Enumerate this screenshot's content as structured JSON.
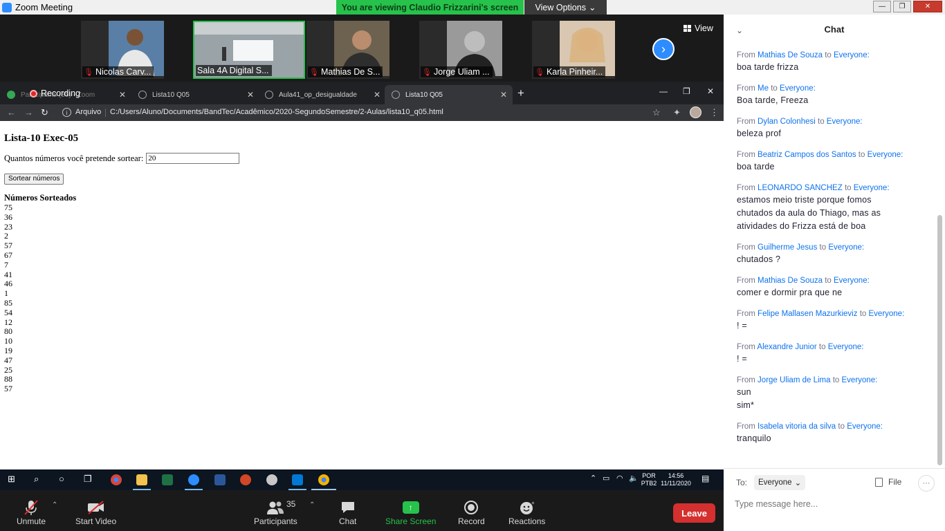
{
  "zoom": {
    "window_title": "Zoom Meeting",
    "viewing_banner": "You are viewing Claudio Frizzarini's screen",
    "view_options": "View Options",
    "view_label": "View"
  },
  "participants_strip": [
    {
      "name": "Nicolas Carv..."
    },
    {
      "name": "Sala 4A Digital S..."
    },
    {
      "name": "Mathias De S..."
    },
    {
      "name": "Jorge Uliam ..."
    },
    {
      "name": "Karla Pinheir..."
    }
  ],
  "recording_label": "Recording",
  "browser": {
    "tabs": [
      {
        "label": "Participants (35) - Zoom"
      },
      {
        "label": "Lista10 Q05"
      },
      {
        "label": "Aula41_op_desigualdade"
      },
      {
        "label": "Lista10 Q05"
      }
    ],
    "address_prefix": "Arquivo",
    "address_url": "C:/Users/Aluno/Documents/BandTec/Acadêmico/2020-SegundoSemestre/2-Aulas/lista10_q05.html"
  },
  "page": {
    "title": "Lista-10 Exec-05",
    "prompt_label": "Quantos números você pretende sortear:",
    "input_value": "20",
    "button_label": "Sortear números",
    "results_heading": "Números Sorteados",
    "numbers": [
      "75",
      "36",
      "23",
      "2",
      "57",
      "67",
      "7",
      "41",
      "46",
      "1",
      "85",
      "54",
      "12",
      "80",
      "10",
      "19",
      "47",
      "25",
      "88",
      "57"
    ]
  },
  "taskbar": {
    "lang_top": "POR",
    "lang_bottom": "PTB2",
    "time": "14:56",
    "date": "11/11/2020"
  },
  "controls": {
    "unmute": "Unmute",
    "start_video": "Start Video",
    "participants": "Participants",
    "participants_count": "35",
    "chat": "Chat",
    "share_screen": "Share Screen",
    "record": "Record",
    "reactions": "Reactions",
    "leave": "Leave"
  },
  "chat": {
    "title": "Chat",
    "from_word": "From",
    "to_word": "to",
    "messages": [
      {
        "from": "Mathias De Souza",
        "to": "Everyone:",
        "lines": [
          "boa tarde frizza"
        ]
      },
      {
        "from": "Me",
        "to": "Everyone:",
        "lines": [
          "Boa tarde, Freeza"
        ]
      },
      {
        "from": "Dylan Colonhesi",
        "to": "Everyone:",
        "lines": [
          "beleza prof"
        ]
      },
      {
        "from": "Beatriz Campos dos Santos",
        "to": "Everyone:",
        "lines": [
          "boa tarde"
        ]
      },
      {
        "from": "LEONARDO SANCHEZ",
        "to": "Everyone:",
        "lines": [
          "estamos meio triste porque fomos",
          "chutados da aula do Thiago, mas as",
          "atividades do Frizza está de boa"
        ]
      },
      {
        "from": "Guilherme Jesus",
        "to": "Everyone:",
        "lines": [
          "chutados ?"
        ]
      },
      {
        "from": "Mathias De Souza",
        "to": "Everyone:",
        "lines": [
          "comer e dormir pra que ne"
        ]
      },
      {
        "from": "Felipe Mallasen Mazurkieviz",
        "to": "Everyone:",
        "lines": [
          "! ="
        ]
      },
      {
        "from": "Alexandre Junior",
        "to": "Everyone:",
        "lines": [
          "! ="
        ]
      },
      {
        "from": "Jorge Uliam de Lima",
        "to": "Everyone:",
        "lines": [
          "sun",
          "sim*"
        ]
      },
      {
        "from": "Isabela vitoria da silva",
        "to": "Everyone:",
        "lines": [
          "tranquilo"
        ]
      }
    ],
    "to_label": "To:",
    "to_value": "Everyone",
    "file_label": "File",
    "input_placeholder": "Type message here..."
  }
}
